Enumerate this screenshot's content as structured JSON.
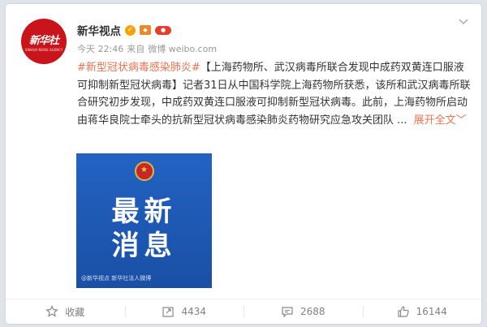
{
  "post": {
    "author": "新华视点",
    "avatar_text": "新华社",
    "avatar_subtext": "XINHUA NEWS AGENCY",
    "time": "今天 22:46",
    "source_prefix": "来自",
    "source": "微博 weibo.com",
    "hashtag": "#新型冠状病毒感染肺炎#",
    "body": "【上海药物所、武汉病毒所联合发现中成药双黄连口服液可抑制新型冠状病毒】记者31日从中国科学院上海药物所获悉，该所和武汉病毒所联合研究初步发现，中成药双黄连口服液可抑制新型冠状病毒。此前，上海药物所启动由蒋华良院士牵头的抗新型冠状病毒感染肺炎药物研究应急攻关团队 ...",
    "expand_label": "展开全文",
    "expand_arrow": "﹀",
    "image": {
      "line1": "最新",
      "line2": "消息",
      "watermark": "@新华视点  新华社法人微博"
    }
  },
  "actions": {
    "favorite_label": "收藏",
    "repost_count": "4434",
    "comment_count": "2688",
    "like_count": "16144"
  },
  "colors": {
    "accent": "#eb7350",
    "image_bg": "#1e56b3",
    "avatar_bg": "#c9141b"
  }
}
